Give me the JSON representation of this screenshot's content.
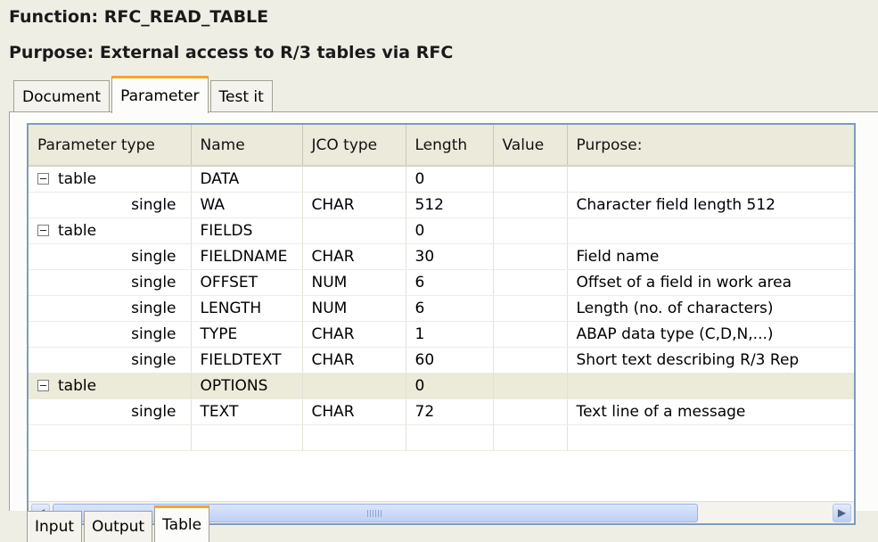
{
  "header": {
    "function_line": "Function: RFC_READ_TABLE",
    "purpose_line": "Purpose:  External access to R/3 tables via RFC"
  },
  "top_tabs": [
    {
      "label": "Document",
      "active": false
    },
    {
      "label": "Parameter",
      "active": true
    },
    {
      "label": "Test it",
      "active": false
    }
  ],
  "table": {
    "columns": [
      "Parameter type",
      "Name",
      "JCO type",
      "Length",
      "Value",
      "Purpose:"
    ],
    "rows": [
      {
        "ptype": "table",
        "name": "DATA",
        "jco": "",
        "length": "0",
        "value": "",
        "purpose": "",
        "group": true,
        "selected": false
      },
      {
        "ptype": "single",
        "name": "WA",
        "jco": "CHAR",
        "length": "512",
        "value": "",
        "purpose": "Character field length 512",
        "group": false,
        "selected": false
      },
      {
        "ptype": "table",
        "name": "FIELDS",
        "jco": "",
        "length": "0",
        "value": "",
        "purpose": "",
        "group": true,
        "selected": false
      },
      {
        "ptype": "single",
        "name": "FIELDNAME",
        "jco": "CHAR",
        "length": "30",
        "value": "",
        "purpose": "Field name",
        "group": false,
        "selected": false
      },
      {
        "ptype": "single",
        "name": "OFFSET",
        "jco": "NUM",
        "length": "6",
        "value": "",
        "purpose": "Offset of a field in work area",
        "group": false,
        "selected": false
      },
      {
        "ptype": "single",
        "name": "LENGTH",
        "jco": "NUM",
        "length": "6",
        "value": "",
        "purpose": "Length (no. of characters)",
        "group": false,
        "selected": false
      },
      {
        "ptype": "single",
        "name": "TYPE",
        "jco": "CHAR",
        "length": "1",
        "value": "",
        "purpose": "ABAP data type (C,D,N,...)",
        "group": false,
        "selected": false
      },
      {
        "ptype": "single",
        "name": "FIELDTEXT",
        "jco": "CHAR",
        "length": "60",
        "value": "",
        "purpose": "Short text describing R/3 Rep",
        "group": false,
        "selected": false
      },
      {
        "ptype": "table",
        "name": "OPTIONS",
        "jco": "",
        "length": "0",
        "value": "",
        "purpose": "",
        "group": true,
        "selected": true
      },
      {
        "ptype": "single",
        "name": "TEXT",
        "jco": "CHAR",
        "length": "72",
        "value": "",
        "purpose": "Text line of a message",
        "group": false,
        "selected": false
      },
      {
        "ptype": "",
        "name": "",
        "jco": "",
        "length": "",
        "value": "",
        "purpose": "",
        "group": false,
        "selected": false
      }
    ]
  },
  "scrollbar": {
    "left_glyph": "◀",
    "right_glyph": "▶"
  },
  "bottom_tabs": [
    {
      "label": "Input",
      "active": false
    },
    {
      "label": "Output",
      "active": false
    },
    {
      "label": "Table",
      "active": true
    }
  ],
  "colors": {
    "accent_tab": "#f4a52a",
    "frame_border": "#7f9db9",
    "selected_row": "#ecead9"
  }
}
